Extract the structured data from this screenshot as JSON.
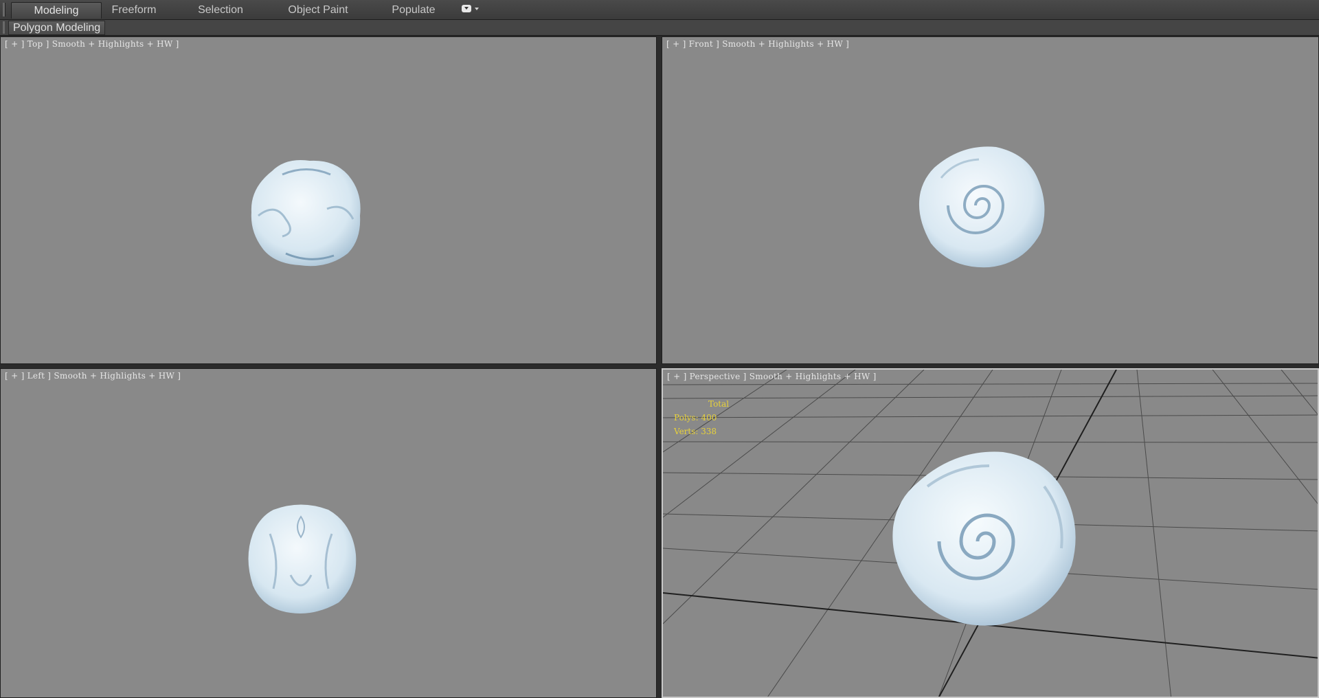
{
  "ribbon": {
    "tabs": [
      {
        "label": "Modeling",
        "active": true
      },
      {
        "label": "Freeform",
        "active": false
      },
      {
        "label": "Selection",
        "active": false
      },
      {
        "label": "Object Paint",
        "active": false
      },
      {
        "label": "Populate",
        "active": false
      }
    ],
    "dropdown_icon": "ribbon-options-icon"
  },
  "subribbon": {
    "label": "Polygon Modeling"
  },
  "viewports": {
    "top": {
      "label": "[ + ] Top ] Smooth + Highlights + HW ]"
    },
    "front": {
      "label": "[ + ] Front ] Smooth + Highlights + HW ]"
    },
    "left": {
      "label": "[ + ] Left ] Smooth + Highlights + HW ]"
    },
    "perspective": {
      "label": "[ + ] Perspective ] Smooth + Highlights + HW ]",
      "stats": {
        "header": "Total",
        "polys": "Polys: 400",
        "verts": "Verts: 338"
      }
    }
  },
  "colors": {
    "viewport_bg": "#898989",
    "stats_text": "#e8d23a",
    "object_fill": "#dceaf3",
    "object_shade": "#9fb9cc"
  }
}
